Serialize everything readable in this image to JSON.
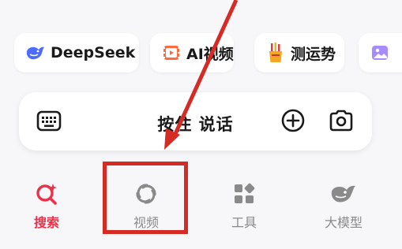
{
  "shortcuts": [
    {
      "label": "DeepSeek",
      "icon": "deepseek-whale-icon"
    },
    {
      "label": "AI视频",
      "icon": "film-icon"
    },
    {
      "label": "测运势",
      "icon": "fortune-sticks-icon"
    },
    {
      "label": "",
      "icon": "image-icon"
    }
  ],
  "voice": {
    "label": "按住 说话"
  },
  "tabs": [
    {
      "label": "搜索",
      "icon": "ai-search-icon",
      "active": true
    },
    {
      "label": "视频",
      "icon": "video-swirl-icon"
    },
    {
      "label": "工具",
      "icon": "tools-grid-icon"
    },
    {
      "label": "大模型",
      "icon": "model-whale-icon"
    }
  ],
  "colors": {
    "accent": "#e8344b",
    "annotation": "#d62b25"
  }
}
